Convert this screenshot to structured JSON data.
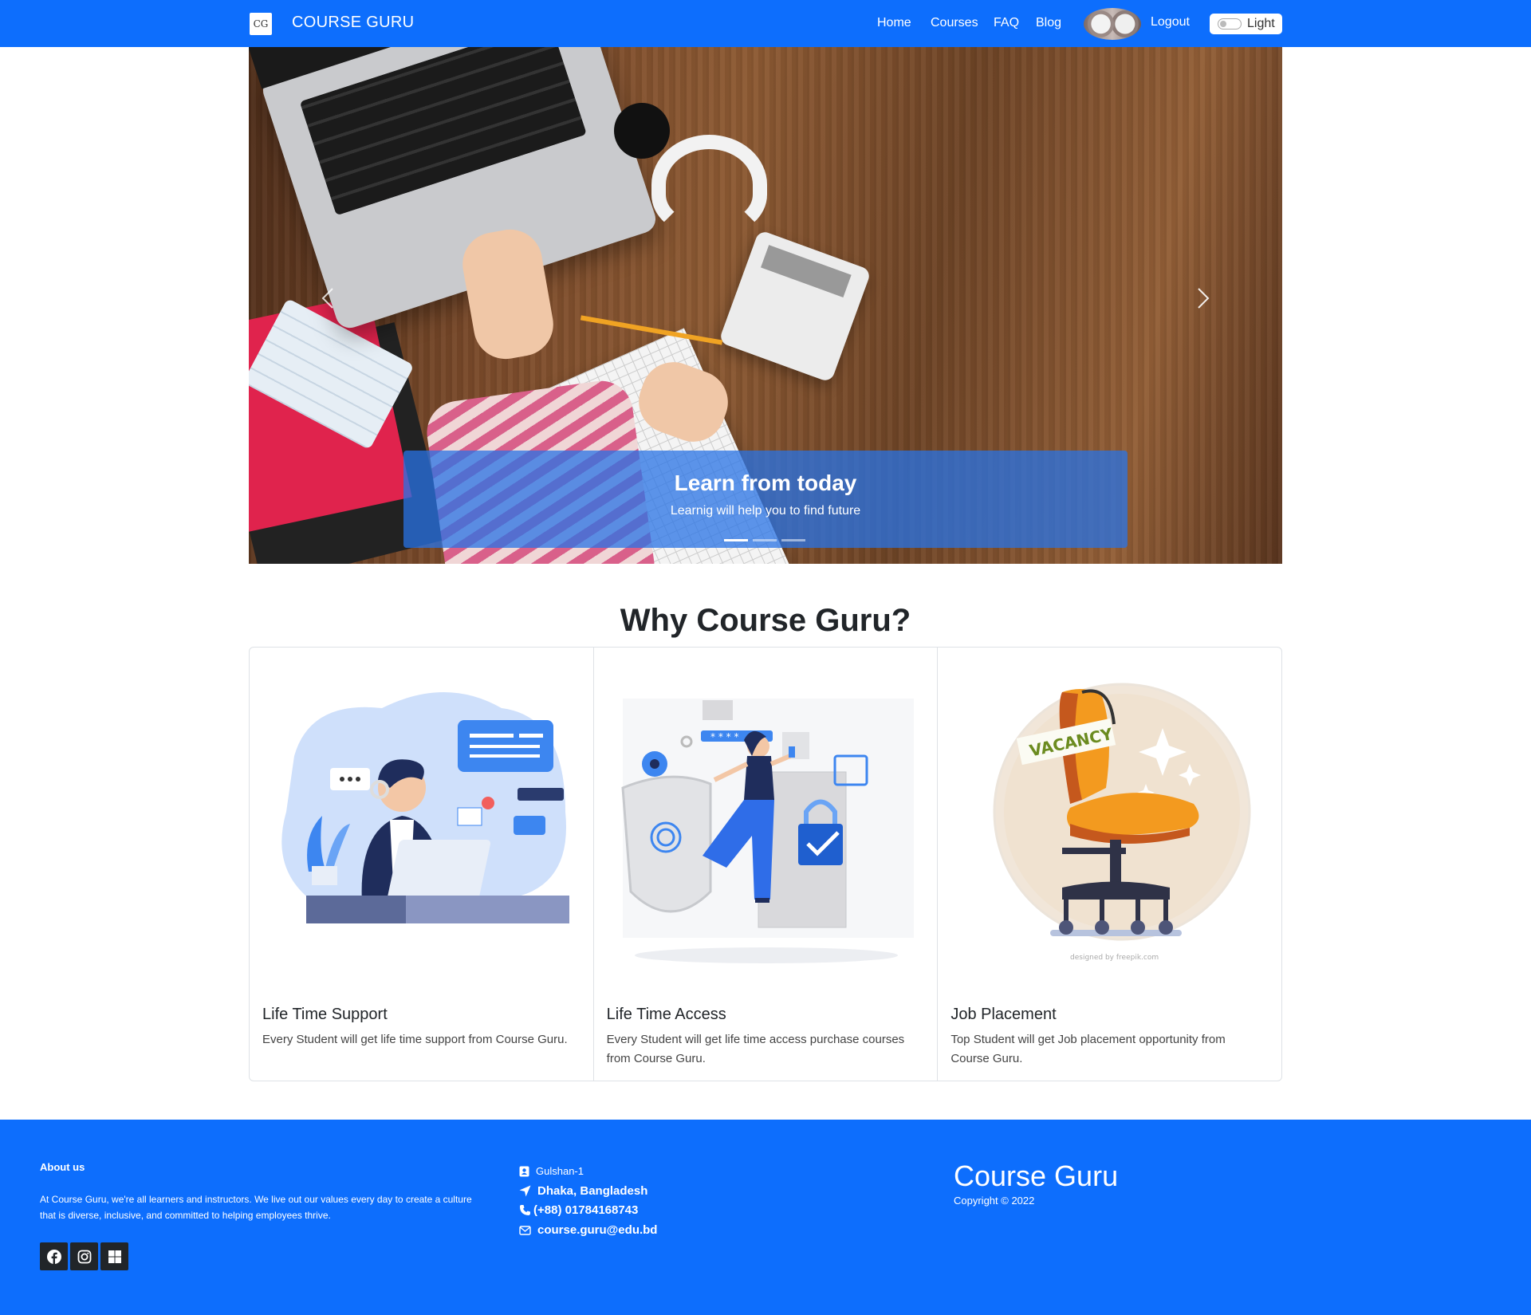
{
  "navbar": {
    "brand_logo": "CG",
    "brand_name": "COURSE GURU",
    "links": [
      "Home",
      "Courses",
      "FAQ",
      "Blog"
    ],
    "logout": "Logout",
    "theme_label": "Light"
  },
  "carousel": {
    "caption_title": "Learn from today",
    "caption_text": "Learnig will help you to find future",
    "active_slide": 1,
    "slide_count": 3,
    "prev_icon": "chevron-left-icon",
    "next_icon": "chevron-right-icon"
  },
  "why": {
    "title": "Why Course Guru?",
    "cards": [
      {
        "title": "Life Time Support",
        "text": "Every Student will get life time support from Course Guru."
      },
      {
        "title": "Life Time Access",
        "text": "Every Student will get life time access purchase courses from Course Guru."
      },
      {
        "title": "Job Placement",
        "text": "Top Student will get Job placement opportunity from Course Guru."
      }
    ],
    "illustration_labels": {
      "vacancy_sign": "VACANCY",
      "credit": "designed by freepik.com"
    }
  },
  "footer": {
    "about_title": "About us",
    "about_text": "At Course Guru, we're all learners and instructors. We live out our values every day to create a culture that is diverse, inclusive, and committed to helping employees thrive.",
    "contact": {
      "area": "Gulshan-1",
      "city": "Dhaka, Bangladesh",
      "phone": "(+88) 01784168743",
      "email": "course.guru@edu.bd"
    },
    "copyright_title": "Course Guru",
    "copyright_text": "Copyright © 2022",
    "social_icons": [
      "facebook-icon",
      "instagram-icon",
      "windows-icon"
    ]
  },
  "colors": {
    "primary": "#0d6efd",
    "dark": "#212529",
    "caption_bg": "#2873e6"
  }
}
